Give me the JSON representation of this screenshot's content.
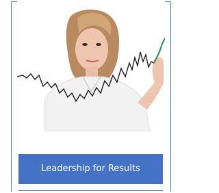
{
  "card": {
    "image": {
      "subject": "woman-pointing-at-stock-chart"
    },
    "button": {
      "label": "Leadership for Results"
    },
    "colors": {
      "border": "#4a7bbf",
      "button_bg": "#4472c4",
      "button_text": "#ffffff"
    }
  }
}
